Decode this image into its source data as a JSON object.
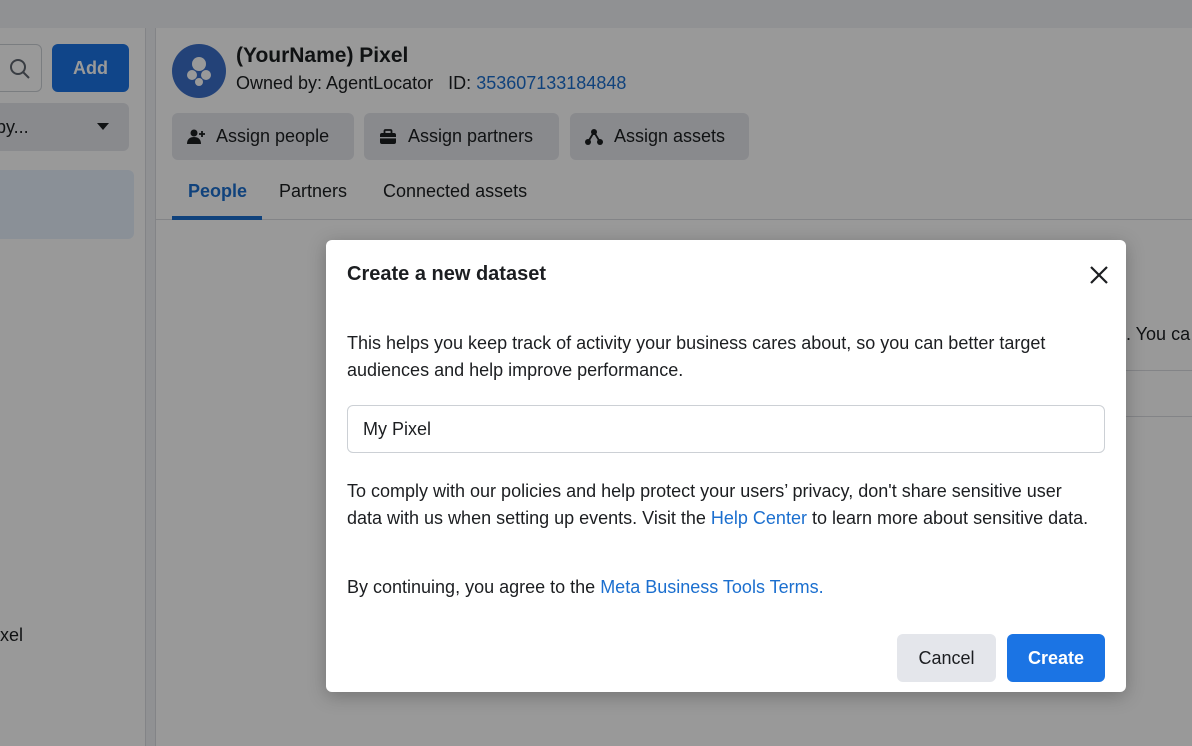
{
  "sidebar": {
    "add_label": "Add",
    "sort_label": "by...",
    "partial_item_label": "xel"
  },
  "header": {
    "title": "(YourName) Pixel",
    "owned_by_text": "Owned by: AgentLocator",
    "id_label": "ID:",
    "id_value": "353607133184848"
  },
  "actions": {
    "assign_people": "Assign people",
    "assign_partners": "Assign partners",
    "assign_assets": "Assign assets"
  },
  "tabs": [
    {
      "label": "People",
      "active": true
    },
    {
      "label": "Partners",
      "active": false
    },
    {
      "label": "Connected assets",
      "active": false
    }
  ],
  "background_text": "el. You ca",
  "modal": {
    "title": "Create a new dataset",
    "description": "This helps you keep track of activity your business cares about, so you can better target audiences and help improve performance.",
    "input_value": "My Pixel",
    "policy_text_1": "To comply with our policies and help protect your users’ privacy, don't share sensitive user data with us when setting up events. Visit the",
    "help_center_link": "Help Center",
    "policy_text_2": "to learn more about sensitive data.",
    "terms_prefix": "By continuing, you agree to the",
    "terms_link": "Meta Business Tools Terms.",
    "cancel_label": "Cancel",
    "create_label": "Create"
  },
  "colors": {
    "accent": "#1b74e4",
    "link": "#1b6fcf",
    "avatar": "#3b6fc9"
  }
}
